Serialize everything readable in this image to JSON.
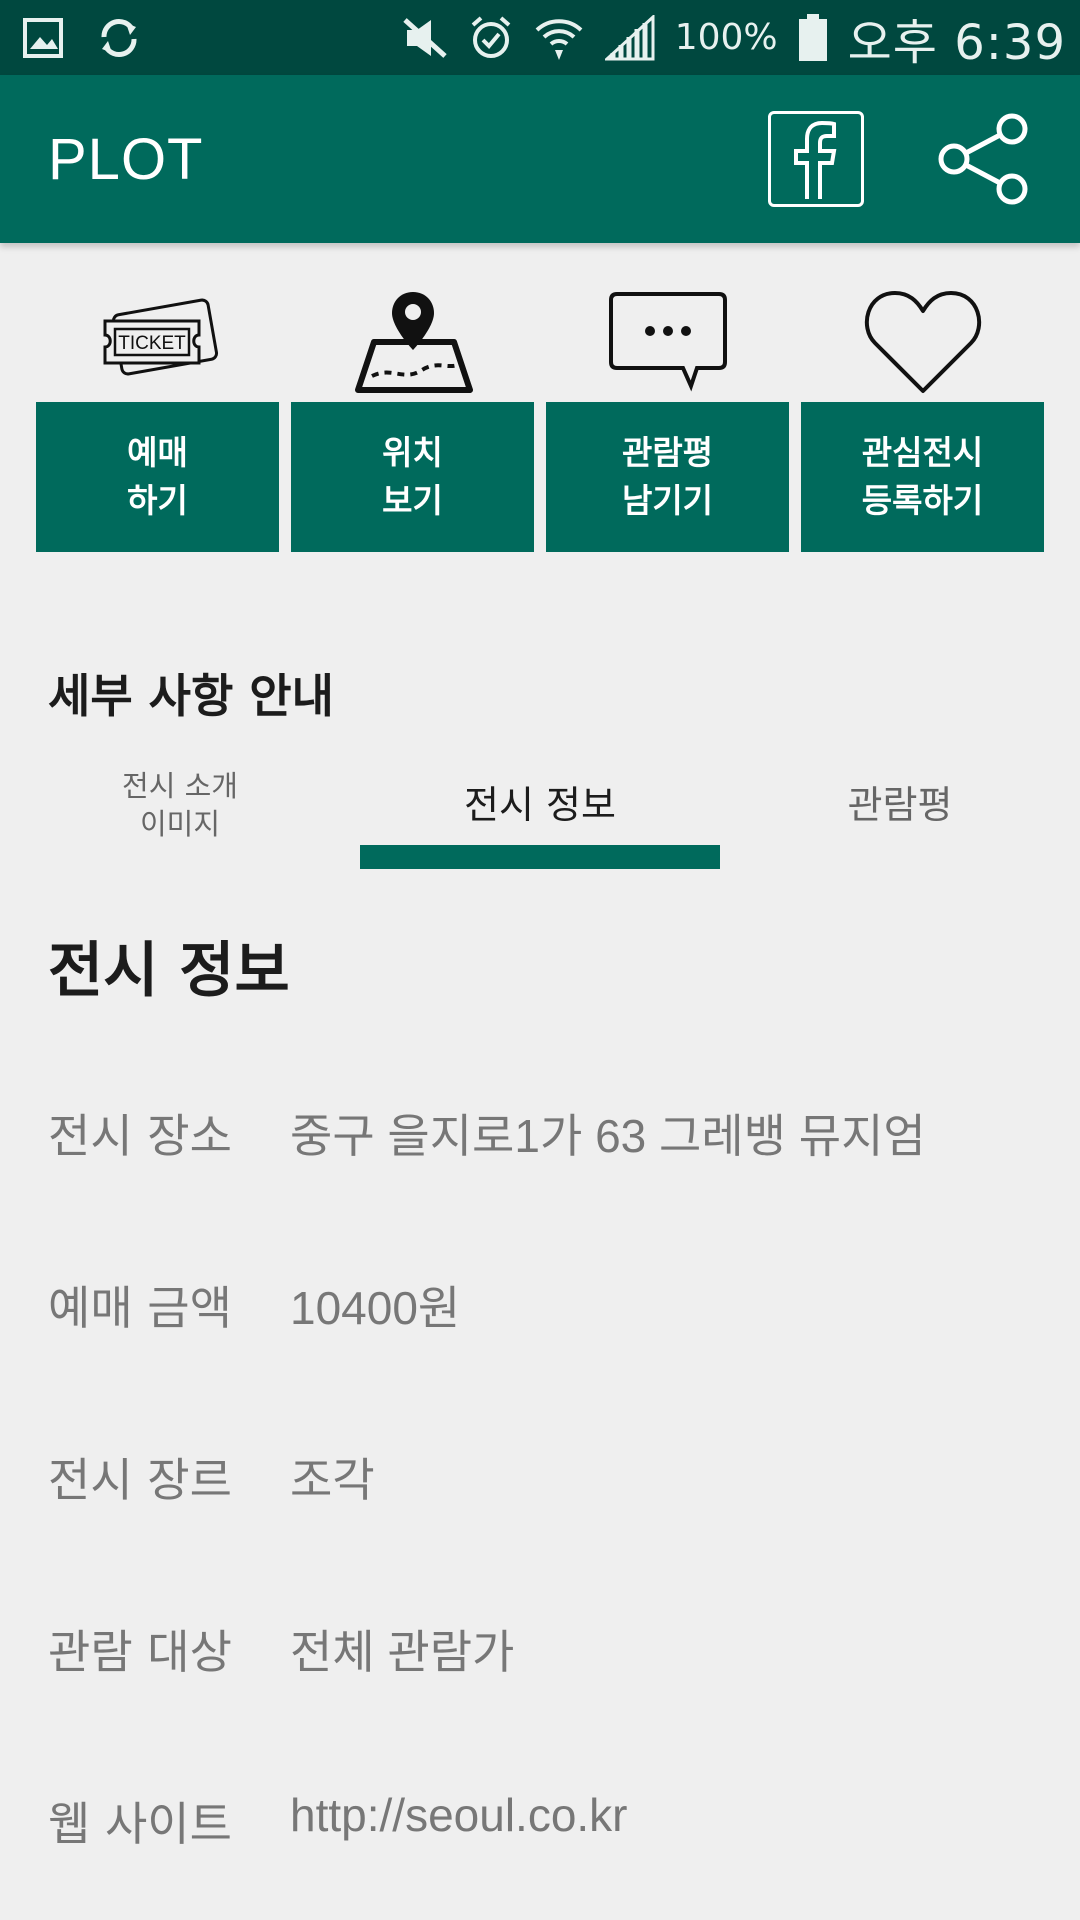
{
  "status_bar": {
    "battery": "100%",
    "time": "오후 6:39",
    "icons": [
      "gallery-icon",
      "sync-icon",
      "mute-icon",
      "alarm-icon",
      "wifi-icon",
      "signal-icon",
      "battery-icon"
    ]
  },
  "app_bar": {
    "title": "PLOT",
    "actions": [
      "facebook-icon",
      "share-icon"
    ]
  },
  "actions": [
    {
      "icon": "ticket-icon",
      "label": "예매\n하기"
    },
    {
      "icon": "map-pin-icon",
      "label": "위치\n보기"
    },
    {
      "icon": "chat-bubble-icon",
      "label": "관람평\n남기기"
    },
    {
      "icon": "heart-icon",
      "label": "관심전시\n등록하기"
    }
  ],
  "icon_text": {
    "ticket": "TICKET"
  },
  "section_title": "세부 사항 안내",
  "tabs": [
    {
      "label": "전시 소개\n이미지",
      "selected": false
    },
    {
      "label": "전시 정보",
      "selected": true
    },
    {
      "label": "관람평",
      "selected": false
    }
  ],
  "detail_title": "전시 정보",
  "details": [
    {
      "label": "전시 장소",
      "value": "중구 을지로1가 63 그레뱅 뮤지엄"
    },
    {
      "label": "예매 금액",
      "value": "10400원"
    },
    {
      "label": "전시 장르",
      "value": "조각"
    },
    {
      "label": "관람 대상",
      "value": "전체 관람가"
    },
    {
      "label": "웹 사이트",
      "value": "http://seoul.co.kr"
    }
  ],
  "colors": {
    "primary": "#006a5c",
    "status_bar": "#00483f",
    "background": "#efefef"
  }
}
